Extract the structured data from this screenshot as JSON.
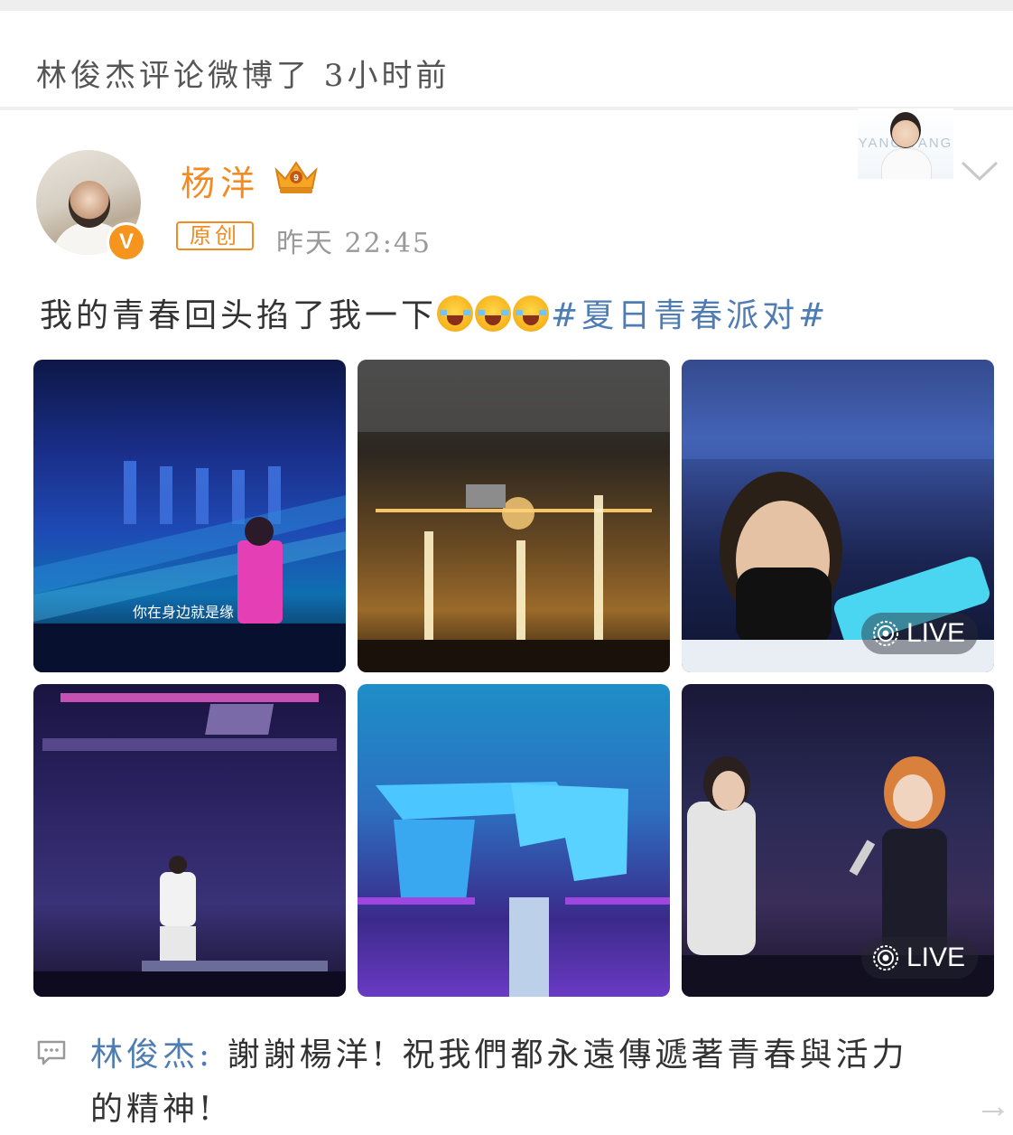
{
  "header": {
    "activity_text": "林俊杰评论微博了 3小时前"
  },
  "post": {
    "user_name": "杨洋",
    "verified_badge": "V",
    "original_badge": "原创",
    "timestamp": "昨天 22:45",
    "text_before_emoji": "我的青春回头掐了我一下",
    "emoji_count": 3,
    "hashtag": "#夏日青春派对#",
    "sticker_text": "YANG YANG",
    "images": [
      {
        "caption": "你在身边就是缘",
        "live": false
      },
      {
        "caption": "",
        "live": false
      },
      {
        "caption": "",
        "live": true
      },
      {
        "caption": "",
        "live": false
      },
      {
        "caption": "",
        "live": false
      },
      {
        "caption": "",
        "live": true
      }
    ],
    "live_label": "LIVE"
  },
  "comment": {
    "commenter": "林俊杰:",
    "text_line1": "謝謝楊洋! 祝我們都永遠傳遞著青春與活力",
    "text_line2": "的精神!"
  },
  "colors": {
    "accent_orange": "#f28b22",
    "link_blue": "#4f7db3",
    "verified_orange": "#f7941d"
  },
  "icons": [
    "crown-level-icon",
    "verified-v-icon",
    "chevron-down-icon",
    "live-photo-icon",
    "comment-icon"
  ]
}
